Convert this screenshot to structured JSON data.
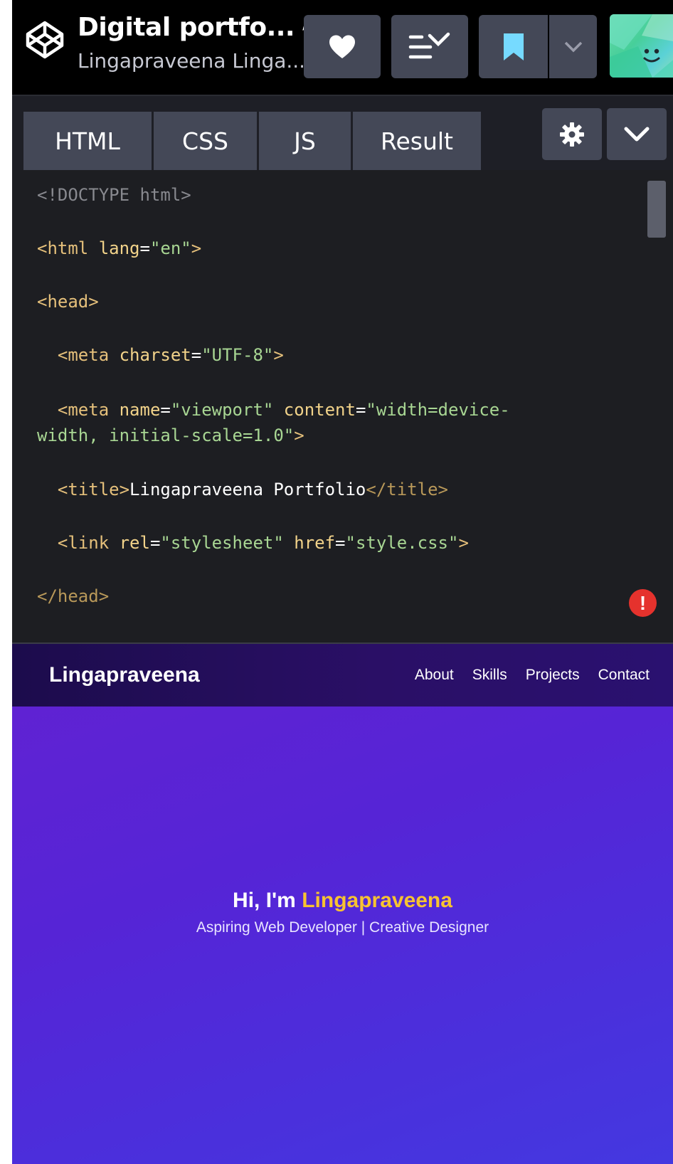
{
  "header": {
    "pen_title": "Digital portfo...",
    "author": "Lingapraveena Linga...",
    "icons": {
      "logo": "codepen-logo-icon",
      "edit": "pencil-icon",
      "heart": "heart-icon",
      "collections": "add-to-collection-icon",
      "save": "bookmark-icon",
      "dropdown": "chevron-down-icon",
      "avatar": "user-avatar"
    }
  },
  "tabs": [
    {
      "label": "HTML"
    },
    {
      "label": "CSS"
    },
    {
      "label": "JS"
    },
    {
      "label": "Result"
    }
  ],
  "toolbar": {
    "settings_icon": "gear-icon",
    "collapse_icon": "chevron-down-icon"
  },
  "editor": {
    "lines": [
      {
        "segments": [
          {
            "t": "<!DOCTYPE html>",
            "c": "doc"
          }
        ]
      },
      {
        "segments": [
          {
            "t": "<html",
            "c": "tag"
          },
          {
            "t": " lang",
            "c": "attr"
          },
          {
            "t": "=",
            "c": "txt"
          },
          {
            "t": "\"en\"",
            "c": "str"
          },
          {
            "t": ">",
            "c": "tag"
          }
        ]
      },
      {
        "segments": [
          {
            "t": "<head>",
            "c": "tag"
          }
        ]
      },
      {
        "segments": [
          {
            "t": "  <meta",
            "c": "tag"
          },
          {
            "t": " charset",
            "c": "attr"
          },
          {
            "t": "=",
            "c": "txt"
          },
          {
            "t": "\"UTF-8\"",
            "c": "str"
          },
          {
            "t": ">",
            "c": "tag"
          }
        ]
      },
      {
        "segments": [
          {
            "t": "  <meta",
            "c": "tag"
          },
          {
            "t": " name",
            "c": "attr"
          },
          {
            "t": "=",
            "c": "txt"
          },
          {
            "t": "\"viewport\"",
            "c": "str"
          },
          {
            "t": " content",
            "c": "attr"
          },
          {
            "t": "=",
            "c": "txt"
          },
          {
            "t": "\"width=device-",
            "c": "str"
          }
        ]
      },
      {
        "segments": [
          {
            "t": "width, initial-scale=1.0\"",
            "c": "str"
          },
          {
            "t": ">",
            "c": "tag"
          }
        ]
      },
      {
        "segments": [
          {
            "t": "  <title>",
            "c": "tag"
          },
          {
            "t": "Lingapraveena Portfolio",
            "c": "txt"
          },
          {
            "t": "</title>",
            "c": "tagd"
          }
        ]
      },
      {
        "segments": [
          {
            "t": "  <link",
            "c": "tag"
          },
          {
            "t": " rel",
            "c": "attr"
          },
          {
            "t": "=",
            "c": "txt"
          },
          {
            "t": "\"stylesheet\"",
            "c": "str"
          },
          {
            "t": " href",
            "c": "attr"
          },
          {
            "t": "=",
            "c": "txt"
          },
          {
            "t": "\"style.css\"",
            "c": "str"
          },
          {
            "t": ">",
            "c": "tag"
          }
        ]
      },
      {
        "segments": [
          {
            "t": "</head>",
            "c": "tagd"
          }
        ]
      }
    ],
    "error_badge": "!"
  },
  "preview": {
    "brand": "Lingapraveena",
    "nav": [
      "About",
      "Skills",
      "Projects",
      "Contact"
    ],
    "hero_prefix": "Hi, I'm ",
    "hero_name": "Lingapraveena",
    "hero_subtitle": "Aspiring Web Developer | Creative Designer"
  },
  "colors": {
    "header_bg": "#000000",
    "button_bg": "#444857",
    "editor_bg": "#1d1e22",
    "save_accent": "#76daff",
    "error": "#e5322d",
    "hero_accent": "#f7c331",
    "preview_gradient_start": "#6222d2",
    "preview_gradient_end": "#4438e0"
  }
}
